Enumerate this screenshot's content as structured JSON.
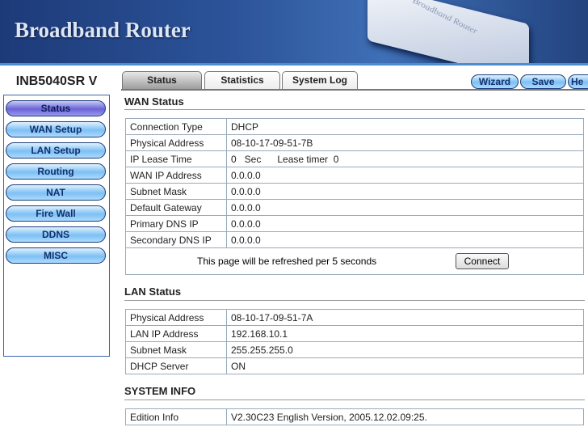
{
  "header": {
    "title": "Broadband Router",
    "device_label": "Broadband Router"
  },
  "model": "INB5040SR V",
  "sidebar": {
    "items": [
      {
        "label": "Status",
        "active": true
      },
      {
        "label": "WAN Setup"
      },
      {
        "label": "LAN Setup"
      },
      {
        "label": "Routing"
      },
      {
        "label": "NAT"
      },
      {
        "label": "Fire Wall"
      },
      {
        "label": "DDNS"
      },
      {
        "label": "MISC"
      }
    ]
  },
  "tabs": [
    {
      "label": "Status",
      "active": true
    },
    {
      "label": "Statistics"
    },
    {
      "label": "System Log"
    }
  ],
  "toolbar": {
    "wizard": "Wizard",
    "save": "Save",
    "help": "He"
  },
  "wan": {
    "title": "WAN Status",
    "rows": [
      [
        "Connection Type",
        "DHCP"
      ],
      [
        "Physical Address",
        "08-10-17-09-51-7B"
      ],
      [
        "IP Lease Time",
        "0   Sec      Lease timer  0"
      ],
      [
        "WAN IP Address",
        "0.0.0.0"
      ],
      [
        "Subnet Mask",
        "0.0.0.0"
      ],
      [
        "Default Gateway",
        "0.0.0.0"
      ],
      [
        "Primary DNS IP",
        "0.0.0.0"
      ],
      [
        "Secondary DNS IP",
        "0.0.0.0"
      ]
    ],
    "refresh_text": "This page will be refreshed per 5 seconds",
    "connect": "Connect"
  },
  "lan": {
    "title": "LAN Status",
    "rows": [
      [
        "Physical Address",
        "08-10-17-09-51-7A"
      ],
      [
        "LAN IP Address",
        "192.168.10.1"
      ],
      [
        "Subnet Mask",
        "255.255.255.0"
      ],
      [
        "DHCP Server",
        "ON"
      ]
    ]
  },
  "system": {
    "title": "SYSTEM INFO",
    "rows": [
      [
        "Edition Info",
        "V2.30C23 English Version, 2005.12.02.09:25."
      ]
    ]
  }
}
